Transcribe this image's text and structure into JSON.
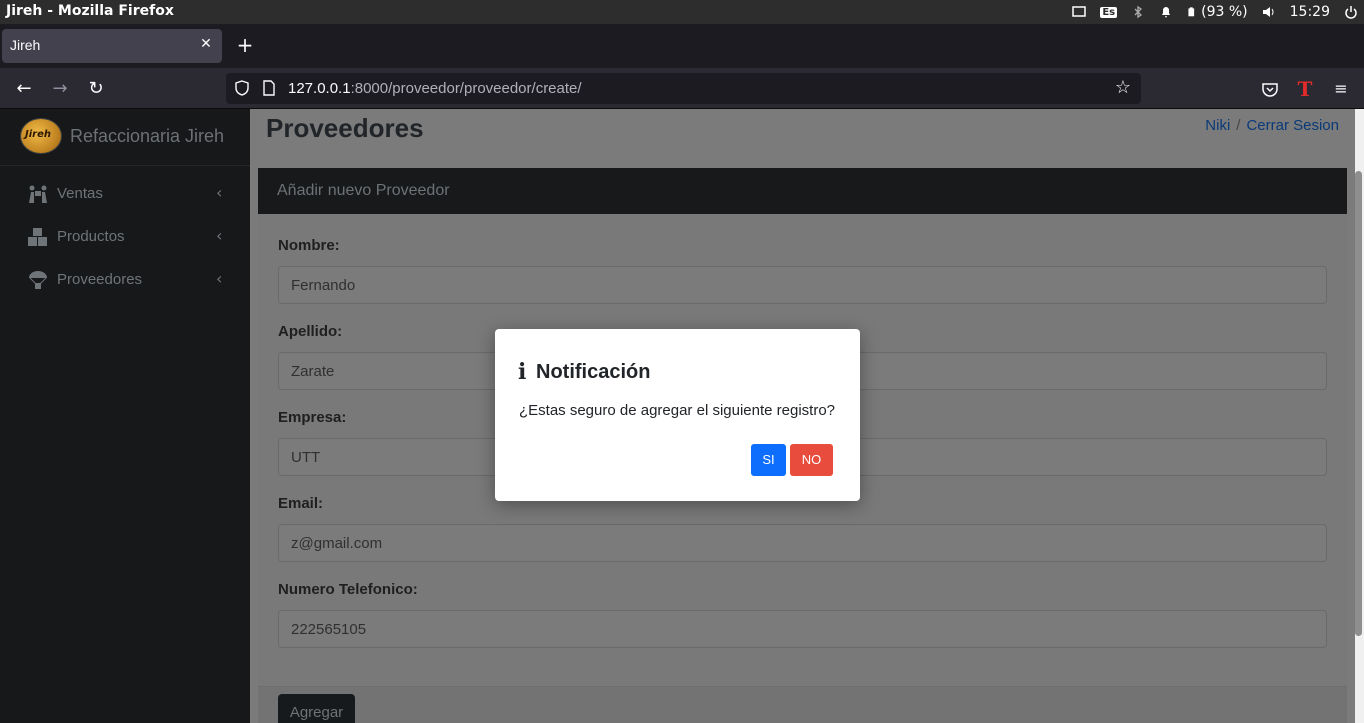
{
  "os": {
    "window_title": "Jireh - Mozilla Firefox",
    "battery": "(93 %)",
    "time": "15:29",
    "keyboard_layout": "Es"
  },
  "browser": {
    "tab_title": "Jireh",
    "url_host": "127.0.0.1",
    "url_rest": ":8000/proveedor/proveedor/create/"
  },
  "sidebar": {
    "brand": "Refaccionaria Jireh",
    "logo_text": "Jireh",
    "items": [
      {
        "label": "Ventas",
        "icon": "people-carry-icon"
      },
      {
        "label": "Productos",
        "icon": "boxes-icon"
      },
      {
        "label": "Proveedores",
        "icon": "parachute-box-icon"
      }
    ]
  },
  "header": {
    "title": "Proveedores",
    "user": "Niki",
    "separator": "/",
    "logout": "Cerrar Sesion"
  },
  "form": {
    "card_title": "Añadir nuevo Proveedor",
    "fields": [
      {
        "label": "Nombre:",
        "value": "Fernando"
      },
      {
        "label": "Apellido:",
        "value": "Zarate"
      },
      {
        "label": "Empresa:",
        "value": "UTT"
      },
      {
        "label": "Email:",
        "value": "z@gmail.com"
      },
      {
        "label": "Numero Telefonico:",
        "value": "222565105"
      }
    ],
    "submit_label": "Agregar"
  },
  "modal": {
    "title": "Notificación",
    "message": "¿Estas seguro de agregar el siguiente registro?",
    "yes_label": "SI",
    "no_label": "NO",
    "icon": "info-icon"
  },
  "colors": {
    "primary": "#0d6efd",
    "danger": "#e74c3c",
    "sidebar_bg": "#16181a"
  }
}
